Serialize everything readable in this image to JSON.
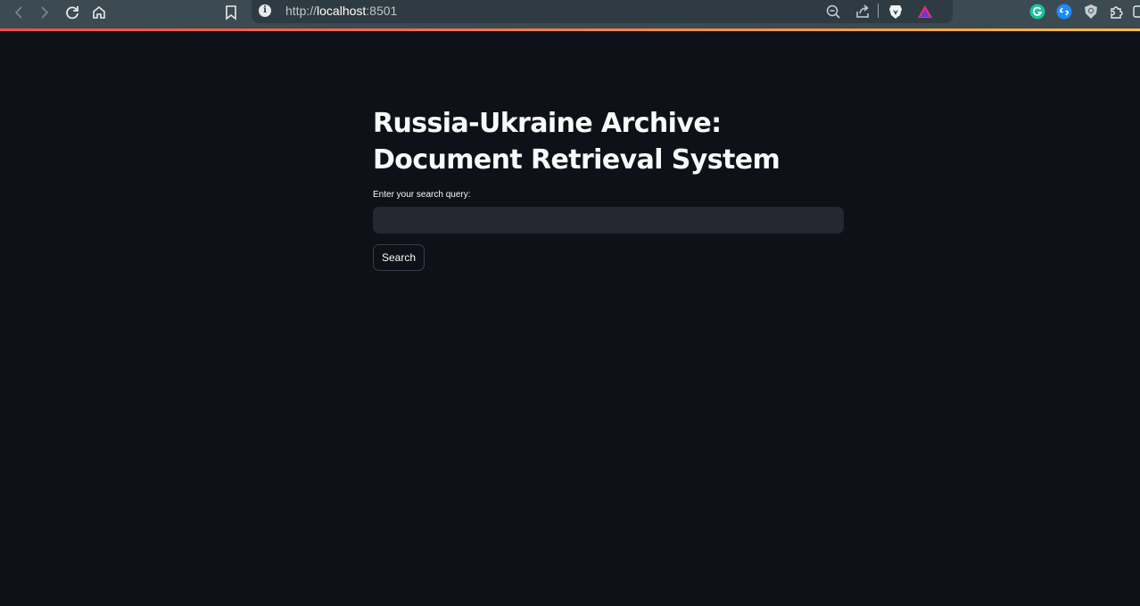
{
  "browser": {
    "url_scheme": "http://",
    "url_host": "localhost",
    "url_port": ":8501",
    "toolbar_icons": [
      "back-icon",
      "forward-icon",
      "reload-icon",
      "home-icon",
      "bookmark-icon"
    ],
    "omnibox_icons": [
      "site-info-icon",
      "zoom-out-icon",
      "share-icon",
      "brave-shields-icon",
      "brave-rewards-icon"
    ],
    "extension_icons": [
      "grammarly-icon",
      "shazam-icon",
      "shield-extension-icon",
      "extensions-puzzle-icon"
    ],
    "accent_colors": [
      "#ff4b4b",
      "#ffbd45"
    ]
  },
  "app": {
    "title": "Russia-Ukraine Archive: Document Retrieval System",
    "search": {
      "label": "Enter your search query:",
      "value": "",
      "placeholder": ""
    },
    "search_button_label": "Search",
    "background_color": "#0e1117",
    "input_color": "#262730"
  }
}
